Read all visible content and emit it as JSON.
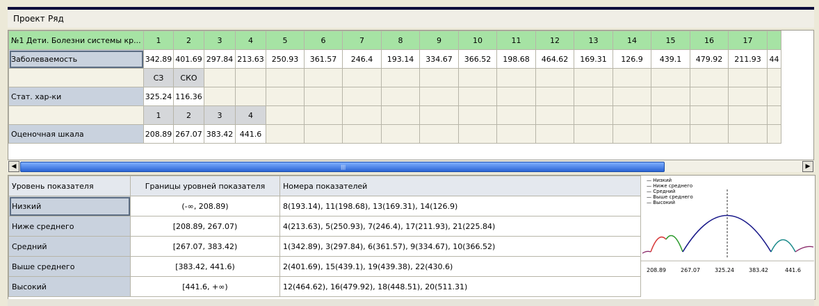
{
  "menu": {
    "items": [
      "Проект",
      "Ряд"
    ]
  },
  "grid": {
    "header_title": "№1 Дети. Болезни системы кр...",
    "columns": [
      "1",
      "2",
      "3",
      "4",
      "5",
      "6",
      "7",
      "8",
      "9",
      "10",
      "11",
      "12",
      "13",
      "14",
      "15",
      "16",
      "17",
      "44"
    ],
    "row_incidence": {
      "label": "Заболеваемость",
      "values": [
        "342.89",
        "401.69",
        "297.84",
        "213.63",
        "250.93",
        "361.57",
        "246.4",
        "193.14",
        "334.67",
        "366.52",
        "198.68",
        "464.62",
        "169.31",
        "126.9",
        "439.1",
        "479.92",
        "211.93",
        "44"
      ]
    },
    "stat_header": [
      "СЗ",
      "СКО"
    ],
    "row_stats": {
      "label": "Стат. хар-ки",
      "values": [
        "325.24",
        "116.36"
      ]
    },
    "scale_header": [
      "1",
      "2",
      "3",
      "4"
    ],
    "row_scale": {
      "label": "Оценочная шкала",
      "values": [
        "208.89",
        "267.07",
        "383.42",
        "441.6"
      ]
    }
  },
  "levels": {
    "headers": [
      "Уровень показателя",
      "Границы уровней показателя",
      "Номера показателей"
    ],
    "rows": [
      {
        "level": "Низкий",
        "bounds": "(-∞, 208.89)",
        "items": "8(193.14), 11(198.68), 13(169.31), 14(126.9)"
      },
      {
        "level": "Ниже среднего",
        "bounds": "[208.89, 267.07)",
        "items": "4(213.63), 5(250.93), 7(246.4), 17(211.93), 21(225.84)"
      },
      {
        "level": "Средний",
        "bounds": "[267.07, 383.42)",
        "items": "1(342.89), 3(297.84), 6(361.57), 9(334.67), 10(366.52)"
      },
      {
        "level": "Выше среднего",
        "bounds": "[383.42, 441.6)",
        "items": "2(401.69), 15(439.1), 19(439.38), 22(430.6)"
      },
      {
        "level": "Высокий",
        "bounds": "[441.6, +∞)",
        "items": "12(464.62), 16(479.92), 18(448.51), 20(511.31)"
      }
    ]
  },
  "mini_chart": {
    "legend": [
      {
        "label": "Низкий",
        "color": "#d83a3a"
      },
      {
        "label": "Ниже среднего",
        "color": "#2e9b2e"
      },
      {
        "label": "Средний",
        "color": "#1a1a8a"
      },
      {
        "label": "Выше среднего",
        "color": "#1a8a8a"
      },
      {
        "label": "Высокий",
        "color": "#8a2a6a"
      }
    ],
    "ticks": [
      "208.89",
      "267.07",
      "325.24",
      "383.42",
      "441.6"
    ]
  }
}
